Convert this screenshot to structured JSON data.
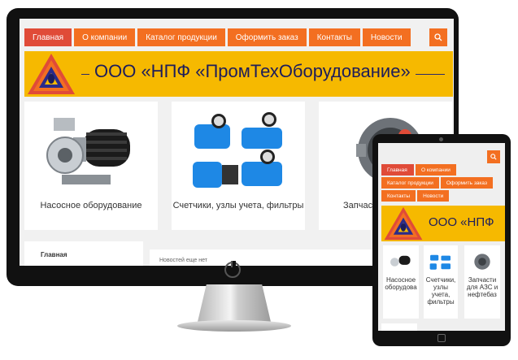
{
  "desktop": {
    "nav": [
      "Главная",
      "О компании",
      "Каталог продукции",
      "Оформить заказ",
      "Контакты",
      "Новости"
    ],
    "active_nav": "Главная",
    "banner_title": "ООО «НПФ «ПромТехОборудование»",
    "products": [
      {
        "title": "Насосное оборудование"
      },
      {
        "title": "Счетчики, узлы учета, фильтры"
      },
      {
        "title": "Запчасти для АЗС и нефтебаз",
        "visible_title": "Запчасти\nнеф"
      }
    ],
    "sidebar_home": "Главная",
    "news_text": "Новостей еще нет"
  },
  "tablet": {
    "nav": [
      "Главная",
      "О компании",
      "Каталог продукции",
      "Оформить заказ",
      "Контакты",
      "Новости"
    ],
    "banner_title": "ООО «НПФ",
    "products": [
      {
        "title": "Насосное оборудова"
      },
      {
        "title": "Счетчики, узлы учета, фильтры"
      },
      {
        "title": "Запчасти для АЗС и нефтебаз"
      }
    ]
  },
  "colors": {
    "accent": "#f36f21",
    "active": "#e04b38",
    "banner": "#f6b900",
    "banner_text": "#1d1d5b"
  },
  "icons": [
    "search-icon",
    "power-icon",
    "logo-icon"
  ]
}
